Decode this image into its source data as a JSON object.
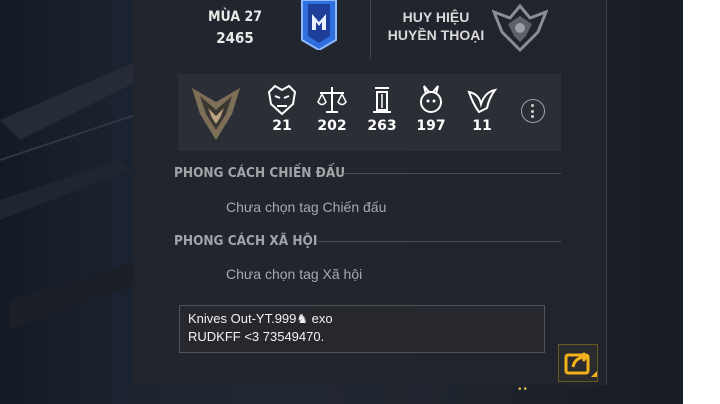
{
  "header": {
    "season_label": "MÙA 27",
    "season_value": "2465",
    "badge_title_line1": "HUY HIỆU",
    "badge_title_line2": "HUYỀN THOẠI"
  },
  "medals": [
    {
      "icon": "samurai-mask-icon",
      "count": "21"
    },
    {
      "icon": "scales-icon",
      "count": "202"
    },
    {
      "icon": "tower-icon",
      "count": "263"
    },
    {
      "icon": "rabbit-emblem-icon",
      "count": "197"
    },
    {
      "icon": "bird-emblem-icon",
      "count": "11"
    }
  ],
  "sections": {
    "battle_style_title": "PHONG CÁCH CHIẾN ĐẤU",
    "battle_style_value": "Chưa chọn tag Chiến đấu",
    "social_style_title": "PHONG CÁCH XÃ HỘI",
    "social_style_value": "Chưa chọn tag Xã hội"
  },
  "bio": {
    "line1": "Knives Out-YT.999♞ exo",
    "line2": "RUDKFF <3  73549470."
  },
  "colors": {
    "accent_gold": "#f2b21b",
    "rank_blue": "#2f6fe0",
    "panel_bg": "#22252c"
  }
}
